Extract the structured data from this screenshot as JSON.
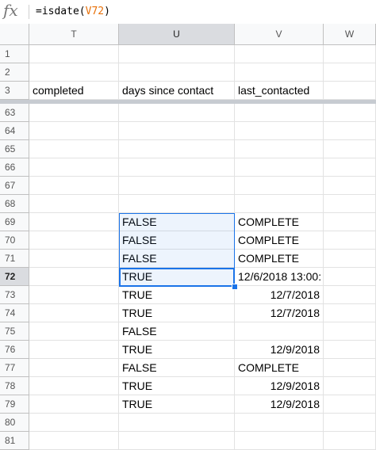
{
  "formula_bar": {
    "fx_label": "fx",
    "formula_prefix": "=isdate(",
    "formula_ref": "V72",
    "formula_suffix": ")"
  },
  "columns": [
    "T",
    "U",
    "V",
    "W"
  ],
  "rows": [
    {
      "num": "1",
      "T": "",
      "U": "",
      "V": ""
    },
    {
      "num": "2",
      "T": "",
      "U": "",
      "V": ""
    },
    {
      "num": "3",
      "T": "completed",
      "U": "days since contact",
      "V": "last_contacted"
    },
    {
      "num": "63",
      "T": "",
      "U": "",
      "V": ""
    },
    {
      "num": "64",
      "T": "",
      "U": "",
      "V": ""
    },
    {
      "num": "65",
      "T": "",
      "U": "",
      "V": ""
    },
    {
      "num": "66",
      "T": "",
      "U": "",
      "V": ""
    },
    {
      "num": "67",
      "T": "",
      "U": "",
      "V": ""
    },
    {
      "num": "68",
      "T": "",
      "U": "",
      "V": ""
    },
    {
      "num": "69",
      "T": "",
      "U": "FALSE",
      "V": "COMPLETE"
    },
    {
      "num": "70",
      "T": "",
      "U": "FALSE",
      "V": "COMPLETE"
    },
    {
      "num": "71",
      "T": "",
      "U": "FALSE",
      "V": "COMPLETE"
    },
    {
      "num": "72",
      "T": "",
      "U": "TRUE",
      "V": "12/6/2018 13:00:"
    },
    {
      "num": "73",
      "T": "",
      "U": "TRUE",
      "V": "12/7/2018"
    },
    {
      "num": "74",
      "T": "",
      "U": "TRUE",
      "V": "12/7/2018"
    },
    {
      "num": "75",
      "T": "",
      "U": "FALSE",
      "V": ""
    },
    {
      "num": "76",
      "T": "",
      "U": "TRUE",
      "V": "12/9/2018"
    },
    {
      "num": "77",
      "T": "",
      "U": "FALSE",
      "V": "COMPLETE"
    },
    {
      "num": "78",
      "T": "",
      "U": "TRUE",
      "V": "12/9/2018"
    },
    {
      "num": "79",
      "T": "",
      "U": "TRUE",
      "V": "12/9/2018"
    },
    {
      "num": "80",
      "T": "",
      "U": "",
      "V": ""
    },
    {
      "num": "81",
      "T": "",
      "U": "",
      "V": ""
    }
  ],
  "active_cell": "U72",
  "colors": {
    "selection": "#1a73e8"
  }
}
